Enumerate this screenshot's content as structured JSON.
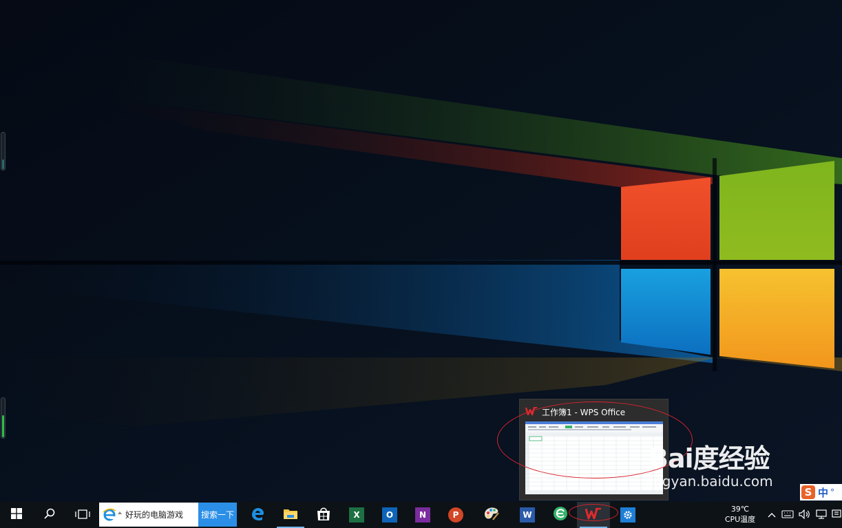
{
  "desktop": {
    "preview": {
      "title": "工作簿1 - WPS Office"
    },
    "watermark": {
      "brand": "Bai度经验",
      "url": "jingyan.baidu.com"
    },
    "ime": {
      "icon_letter": "S",
      "mode": "中",
      "punct": "°"
    }
  },
  "taskbar": {
    "search": {
      "query": "好玩的电脑游戏",
      "button_label": "搜索一下"
    },
    "apps": [
      {
        "name": "Edge",
        "icon": "edge-icon"
      },
      {
        "name": "File Explorer",
        "icon": "folder-icon",
        "running": true
      },
      {
        "name": "Microsoft Store",
        "icon": "store-icon"
      },
      {
        "name": "Excel",
        "icon": "excel-icon",
        "letter": "X"
      },
      {
        "name": "Outlook",
        "icon": "outlook-icon",
        "letter": "O"
      },
      {
        "name": "OneNote",
        "icon": "onenote-icon",
        "letter": "N"
      },
      {
        "name": "PowerPoint",
        "icon": "powerpoint-icon",
        "letter": "P"
      },
      {
        "name": "Paint",
        "icon": "paint-icon"
      },
      {
        "name": "Word",
        "icon": "word-icon",
        "letter": "W"
      },
      {
        "name": "360 Browser",
        "icon": "browser-icon"
      },
      {
        "name": "WPS Office",
        "icon": "wps-icon",
        "active": true
      },
      {
        "name": "Settings",
        "icon": "settings-icon"
      }
    ],
    "tray": {
      "temperature": "39℃",
      "temperature_label": "CPU温度",
      "ime_label": "",
      "clock": ""
    }
  },
  "colors": {
    "taskbar": "#0d1216",
    "search_button": "#2b8fe8",
    "highlight": "#d9232e",
    "wps_red": "#e02a2e"
  }
}
